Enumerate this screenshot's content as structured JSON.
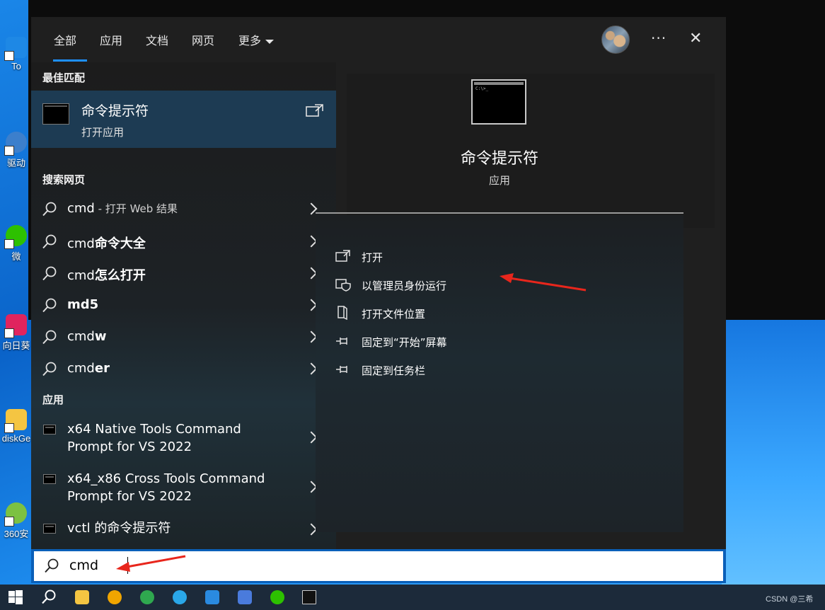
{
  "desktop": {
    "icons": [
      {
        "label": "To",
        "color": "#1e88e5"
      },
      {
        "label": "驱动",
        "color": "#3c7fcc"
      },
      {
        "label": "微",
        "color": "#2dc100"
      },
      {
        "label": "向日葵",
        "color": "#e0245e"
      },
      {
        "label": "diskGe",
        "color": "#f4c542"
      },
      {
        "label": "360安",
        "color": "#7cc142"
      }
    ]
  },
  "tabs": [
    {
      "label": "全部",
      "active": true
    },
    {
      "label": "应用"
    },
    {
      "label": "文档"
    },
    {
      "label": "网页"
    },
    {
      "label": "更多"
    }
  ],
  "header": {
    "more_dots": "···",
    "close": "✕"
  },
  "sections": {
    "best_match": "最佳匹配",
    "search_web": "搜索网页",
    "apps": "应用"
  },
  "best_match": {
    "title": "命令提示符",
    "subtitle": "打开应用"
  },
  "web_results": [
    {
      "prefix": "cmd",
      "bold": "",
      "suffix": " - 打开 Web 结果"
    },
    {
      "prefix": "cmd",
      "bold": "命令大全",
      "suffix": ""
    },
    {
      "prefix": "cmd",
      "bold": "怎么打开",
      "suffix": ""
    },
    {
      "prefix": "",
      "bold": "md5",
      "suffix": ""
    },
    {
      "prefix": "cmd",
      "bold": "w",
      "suffix": ""
    },
    {
      "prefix": "cmd",
      "bold": "er",
      "suffix": ""
    }
  ],
  "apps": [
    {
      "line1": "x64 Native Tools Command",
      "line2": "Prompt for VS 2022"
    },
    {
      "line1": "x64_x86 Cross Tools Command",
      "line2": "Prompt for VS 2022"
    },
    {
      "line1": "vctl 的命令提示符",
      "line2": ""
    }
  ],
  "preview": {
    "title": "命令提示符",
    "type": "应用"
  },
  "actions": [
    {
      "label": "打开",
      "icon": "open-icon"
    },
    {
      "label": "以管理员身份运行",
      "icon": "admin-shield-icon"
    },
    {
      "label": "打开文件位置",
      "icon": "file-location-icon"
    },
    {
      "label": "固定到“开始”屏幕",
      "icon": "pin-icon"
    },
    {
      "label": "固定到任务栏",
      "icon": "pin-icon"
    }
  ],
  "search": {
    "value": "cmd"
  },
  "taskbar": {
    "apps": [
      {
        "name": "start-button",
        "color": "#ffffff"
      },
      {
        "name": "search-button",
        "color": "#ffffff"
      },
      {
        "name": "file-explorer",
        "color": "#f4c542"
      },
      {
        "name": "chrome-like-browser",
        "color": "#f0a500"
      },
      {
        "name": "360-app",
        "color": "#2fa84f"
      },
      {
        "name": "edge",
        "color": "#2aa7e8"
      },
      {
        "name": "vscode",
        "color": "#2a8ae0"
      },
      {
        "name": "feishu-app",
        "color": "#4a7bdc"
      },
      {
        "name": "wechat",
        "color": "#2dc100"
      },
      {
        "name": "terminal",
        "color": "#cccccc"
      }
    ],
    "watermark": "CSDN @三希"
  }
}
